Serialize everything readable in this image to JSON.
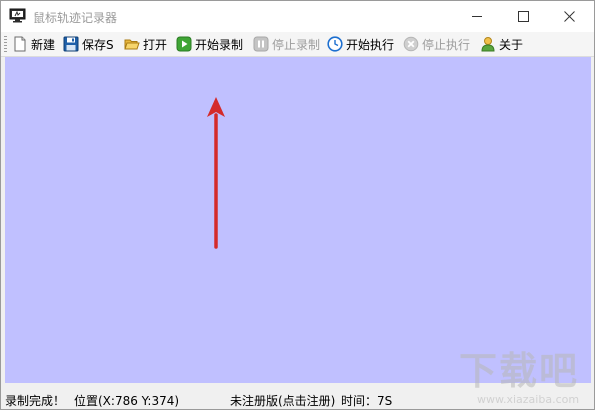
{
  "window": {
    "title": "鼠标轨迹记录器"
  },
  "toolbar": {
    "items": [
      {
        "label": "新建",
        "icon": "new-file-icon",
        "enabled": true
      },
      {
        "label": "保存S",
        "icon": "save-icon",
        "enabled": true
      },
      {
        "label": "打开",
        "icon": "open-folder-icon",
        "enabled": true
      },
      {
        "label": "开始录制",
        "icon": "play-icon",
        "enabled": true
      },
      {
        "label": "停止录制",
        "icon": "pause-icon",
        "enabled": false
      },
      {
        "label": "开始执行",
        "icon": "clock-icon",
        "enabled": true
      },
      {
        "label": "停止执行",
        "icon": "stop-icon",
        "enabled": false
      },
      {
        "label": "关于",
        "icon": "user-icon",
        "enabled": true
      }
    ]
  },
  "canvas": {
    "background": "#c0c0ff",
    "annotation_color": "#d42a2a"
  },
  "status": {
    "message": "录制完成！",
    "position": "位置(X:786 Y:374)",
    "registration": "未注册版(点击注册)",
    "time": "时间：7S"
  },
  "watermark": {
    "main": "下载吧",
    "url": "www.xiazaiba.com"
  }
}
